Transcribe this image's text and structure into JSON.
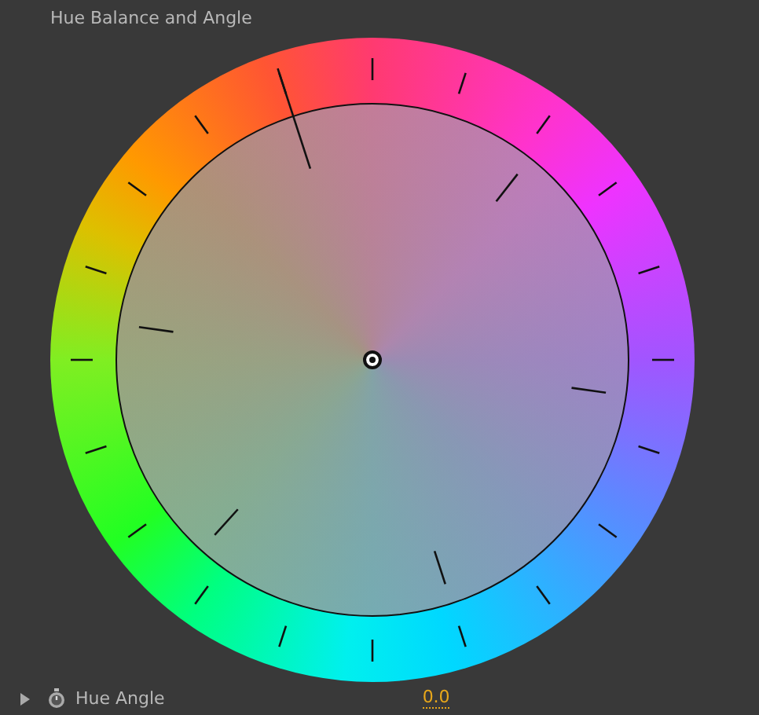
{
  "panel": {
    "title": "Hue Balance and Angle"
  },
  "property": {
    "label": "Hue Angle",
    "value": "0.0",
    "expanded": false
  }
}
